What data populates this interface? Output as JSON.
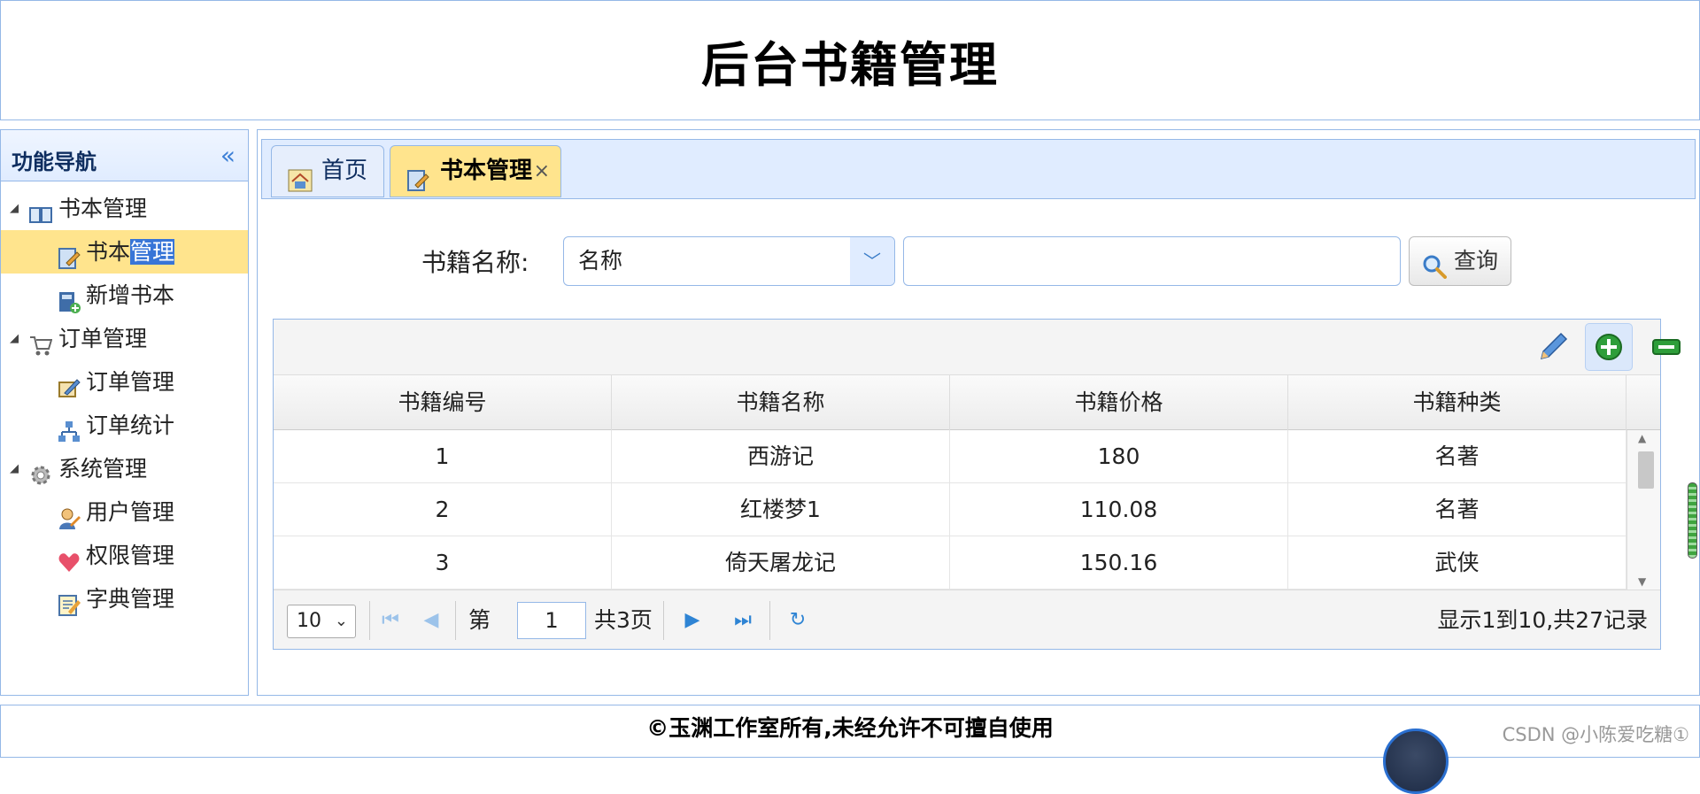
{
  "header": {
    "title": "后台书籍管理"
  },
  "west": {
    "title": "功能导航",
    "collapse_icon": "double-chevron-left-icon",
    "tree": [
      {
        "label": "书本管理",
        "icon": "book-icon",
        "level": 0
      },
      {
        "label_a": "书本",
        "label_b": "管理",
        "icon": "edit-note-icon",
        "level": 1,
        "selected": true
      },
      {
        "label": "新增书本",
        "icon": "add-book-icon",
        "level": 1
      },
      {
        "label": "订单管理",
        "icon": "cart-icon",
        "level": 0
      },
      {
        "label": "订单管理",
        "icon": "order-edit-icon",
        "level": 1
      },
      {
        "label": "订单统计",
        "icon": "org-chart-icon",
        "level": 1
      },
      {
        "label": "系统管理",
        "icon": "gear-icon",
        "level": 0
      },
      {
        "label": "用户管理",
        "icon": "user-icon",
        "level": 1
      },
      {
        "label": "权限管理",
        "icon": "heart-icon",
        "level": 1
      },
      {
        "label": "字典管理",
        "icon": "dictionary-icon",
        "level": 1
      }
    ]
  },
  "tabs": [
    {
      "label": "首页",
      "icon": "home-icon",
      "active": false
    },
    {
      "label": "书本管理",
      "icon": "edit-note-icon",
      "active": true,
      "close": "×"
    }
  ],
  "search": {
    "label": "书籍名称:",
    "select_value": "名称",
    "dropdown_icon": "chevron-down-icon",
    "input_value": "",
    "button_label": "查询",
    "button_icon": "magnifier-icon"
  },
  "toolbar": {
    "icons": [
      "pencil-icon",
      "add-icon",
      "remove-icon"
    ]
  },
  "table": {
    "columns": [
      "书籍编号",
      "书籍名称",
      "书籍价格",
      "书籍种类"
    ],
    "rows": [
      [
        "1",
        "西游记",
        "180",
        "名著"
      ],
      [
        "2",
        "红楼梦1",
        "110.08",
        "名著"
      ],
      [
        "3",
        "倚天屠龙记",
        "150.16",
        "武侠"
      ]
    ]
  },
  "pager": {
    "page_size": "10",
    "prefix": "第",
    "page": "1",
    "suffix": "共3页",
    "info": "显示1到10,共27记录"
  },
  "footer": {
    "copyright": "©玉渊工作室所有,未经允许不可擅自使用"
  },
  "watermark": "CSDN @小陈爱吃糖①",
  "colors": {
    "border": "#95b8e7",
    "tab_active": "#ffe48d",
    "panel_header": "#e0ecff",
    "selection": "#3875d7"
  }
}
